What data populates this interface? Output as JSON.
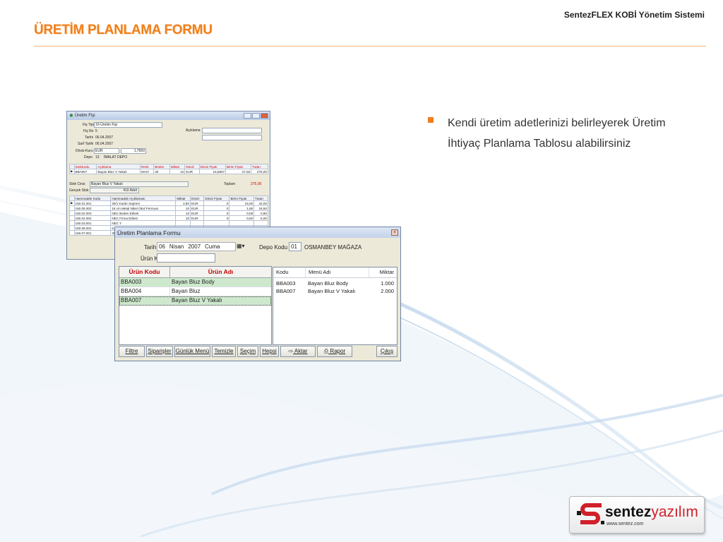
{
  "header": {
    "brand": "SentezFLEX KOBİ Yönetim Sistemi",
    "title": "ÜRETİM PLANLAMA FORMU"
  },
  "bullet": {
    "text": "Kendi üretim adetlerinizi belirleyerek Üretim İhtiyaç Planlama Tablosu alabilirsiniz"
  },
  "back_window": {
    "title": "Üretim Fişi",
    "fis_tipi_label": "Fiş Tipi",
    "fis_tipi_value": "10-Üretim Fişi",
    "fis_no_label": "Fiş No",
    "fis_no_value": "5",
    "tarih_label": "Tarihi",
    "tarih_value": "06.04.2007",
    "sevk_label": "Sarf Tarihi",
    "sevk_value": "06.04.2007",
    "doviz_label": "Döviz-Kuru",
    "doviz_value": "EUR",
    "kur_value": "1,7650",
    "depo_label": "Depo",
    "depo_code": "13",
    "depo_name": "İMALAT DEPO",
    "aciklama_label": "Açıklama",
    "top_table": {
      "headers": [
        "StokKodu",
        "Açıklama",
        "Renk",
        "Beden",
        "Miktar",
        "Döviz",
        "Döviz Fiyatı",
        "Birim Fiyatı",
        "Tutarı"
      ],
      "rows": [
        [
          "BBA007",
          "Bayan Bluz V Yakalı",
          "MAVİ",
          "40",
          "10",
          "EUR",
          "15,5807",
          "27,50",
          "275,00"
        ]
      ]
    },
    "stok_cinsi_label": "Stok Cinsi",
    "stok_cinsi_value": "Bayan Bluz V Yakalı",
    "toplam_label": "Toplam",
    "toplam_value": "275,00",
    "gercek_stok_label": "Gerçek Stok",
    "gercek_stok_value": "410 Adet",
    "bottom_table": {
      "headers": [
        "Hammadde Kodu",
        "Hammadde Açıklaması",
        "Miktar",
        "Döviz",
        "Döviz Fiyatı",
        "Birim Fiyatı",
        "Tutarı"
      ],
      "rows": [
        [
          "150.01.001",
          "30/1 Karde Süprem",
          "2,80",
          "EUR",
          "0",
          "15,00",
          "42,00"
        ],
        [
          "150.05.002",
          "16 cm Metal Nikel Okul Fermuar",
          "10",
          "EUR",
          "0",
          "1,85",
          "18,50"
        ],
        [
          "150.02.003",
          "NEC Beden Etiketi",
          "10",
          "EUR",
          "0",
          "0,08",
          "0,80"
        ],
        [
          "150.02.002",
          "NEC Firma Etiketi",
          "10",
          "EUR",
          "0",
          "0,50",
          "5,00"
        ],
        [
          "150.03.001",
          "NEC Y",
          "",
          "",
          "",
          "",
          ""
        ],
        [
          "150.06.001",
          "6,5 cm",
          "",
          "",
          "",
          "",
          ""
        ],
        [
          "150.07.001",
          "35 * 45",
          "",
          "",
          "",
          "",
          ""
        ]
      ]
    }
  },
  "front_window": {
    "title": "Üretim Planlama Formu",
    "tarih_label": "Tarih",
    "tarih_day": "06",
    "tarih_month": "Nisan",
    "tarih_year": "2007",
    "tarih_weekday": "Cuma",
    "depo_label": "Depo Kodu",
    "depo_code": "01",
    "depo_name": "OSMANBEY MAĞAZA",
    "urun_kodu_label": "Ürün Kodu",
    "urun_kodu_value": "",
    "left_grid": {
      "headers": [
        "Ürün Kodu",
        "Ürün Adı"
      ],
      "rows": [
        {
          "code": "BBA003",
          "name": "Bayan Bluz Body",
          "selected": true
        },
        {
          "code": "BBA004",
          "name": "Bayan Bluz",
          "selected": false
        },
        {
          "code": "BBA007",
          "name": "Bayan Bluz V Yakalı",
          "selected": true
        }
      ]
    },
    "right_grid": {
      "headers": [
        "Kodu",
        "Menü Adı",
        "Miktar"
      ],
      "rows": [
        {
          "code": "BBA003",
          "name": "Bayan Bluz Body",
          "qty": "1.000"
        },
        {
          "code": "BBA007",
          "name": "Bayan Bluz V Yakalı",
          "qty": "2.000"
        }
      ]
    },
    "buttons": [
      "Filtre",
      "Siparişler",
      "Günlük Menü",
      "Temizle",
      "Seçim",
      "Hepsi",
      "Aktar",
      "Rapor",
      "Çıkış"
    ]
  },
  "logo": {
    "brand_black": "sentez",
    "brand_red": "yazılım",
    "url": "www.sentez.com"
  },
  "colors": {
    "accent": "#f07f1a",
    "grid_header_text": "#c00000",
    "selected_row": "#cde8cc"
  }
}
